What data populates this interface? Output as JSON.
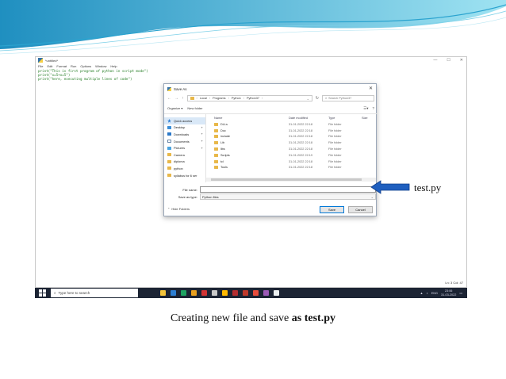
{
  "editor": {
    "title": "*untitled*",
    "window_controls": [
      "—",
      "☐",
      "✕"
    ],
    "menu": [
      "File",
      "Edit",
      "Format",
      "Run",
      "Options",
      "Window",
      "Help"
    ],
    "code_lines": [
      "print(\"This is first program of python in script mode\")",
      "print(\"x=5+x=5\")",
      "print(\"here, executing multiple lines of code\")"
    ],
    "status": "Ln: 3  Col: 47"
  },
  "dialog": {
    "title": "Save As",
    "breadcrumb": [
      "Local",
      "Programs",
      "Python",
      "Python37"
    ],
    "search_placeholder": "Search Python37",
    "organize_label": "Organize ▾",
    "new_folder_label": "New folder",
    "nav_items": [
      {
        "label": "Quick access",
        "icon": "star"
      },
      {
        "label": "Desktop",
        "icon": "desk"
      },
      {
        "label": "Downloads",
        "icon": "down"
      },
      {
        "label": "Documents",
        "icon": "docs"
      },
      {
        "label": "Pictures",
        "icon": "pics"
      },
      {
        "label": "Camera",
        "icon": "fold"
      },
      {
        "label": "diploma",
        "icon": "fold"
      },
      {
        "label": "python",
        "icon": "fold"
      },
      {
        "label": "syllabus for 6 ser",
        "icon": "fold"
      }
    ],
    "columns": {
      "name": "Name",
      "date": "Date modified",
      "type": "Type",
      "size": "Size"
    },
    "files": [
      {
        "name": "DLLs",
        "date": "31-01-2022 22:18",
        "type": "File folder"
      },
      {
        "name": "Doc",
        "date": "31-01-2022 22:18",
        "type": "File folder"
      },
      {
        "name": "include",
        "date": "31-01-2022 22:18",
        "type": "File folder"
      },
      {
        "name": "Lib",
        "date": "31-01-2022 22:18",
        "type": "File folder"
      },
      {
        "name": "libs",
        "date": "31-01-2022 22:18",
        "type": "File folder"
      },
      {
        "name": "Scripts",
        "date": "31-01-2022 22:19",
        "type": "File folder"
      },
      {
        "name": "tcl",
        "date": "31-01-2022 22:18",
        "type": "File folder"
      },
      {
        "name": "Tools",
        "date": "31-01-2022 22:18",
        "type": "File folder"
      }
    ],
    "file_name_label": "File name:",
    "file_name_value": "",
    "save_type_label": "Save as type:",
    "save_type_value": "Python files",
    "hide_folders_label": "Hide Folders",
    "save_label": "Save",
    "cancel_label": "Cancel"
  },
  "annotation": {
    "arrow_color": "#1f5fbf",
    "label": "test.py"
  },
  "taskbar": {
    "search_placeholder": "Type here to search",
    "lang": "ENG",
    "time": "23:06",
    "date": "31-03-2022",
    "app_colors": [
      "#f3c33a",
      "#2d7fd3",
      "#1ea362",
      "#e8a020",
      "#d23434",
      "#c9c9c9",
      "#ffb900",
      "#b52e31",
      "#c0392b",
      "#e74c3c",
      "#9b59b6",
      "#ecf0f1"
    ]
  },
  "caption": {
    "prefix": "Creating new file and save ",
    "bold": "as test.py"
  }
}
